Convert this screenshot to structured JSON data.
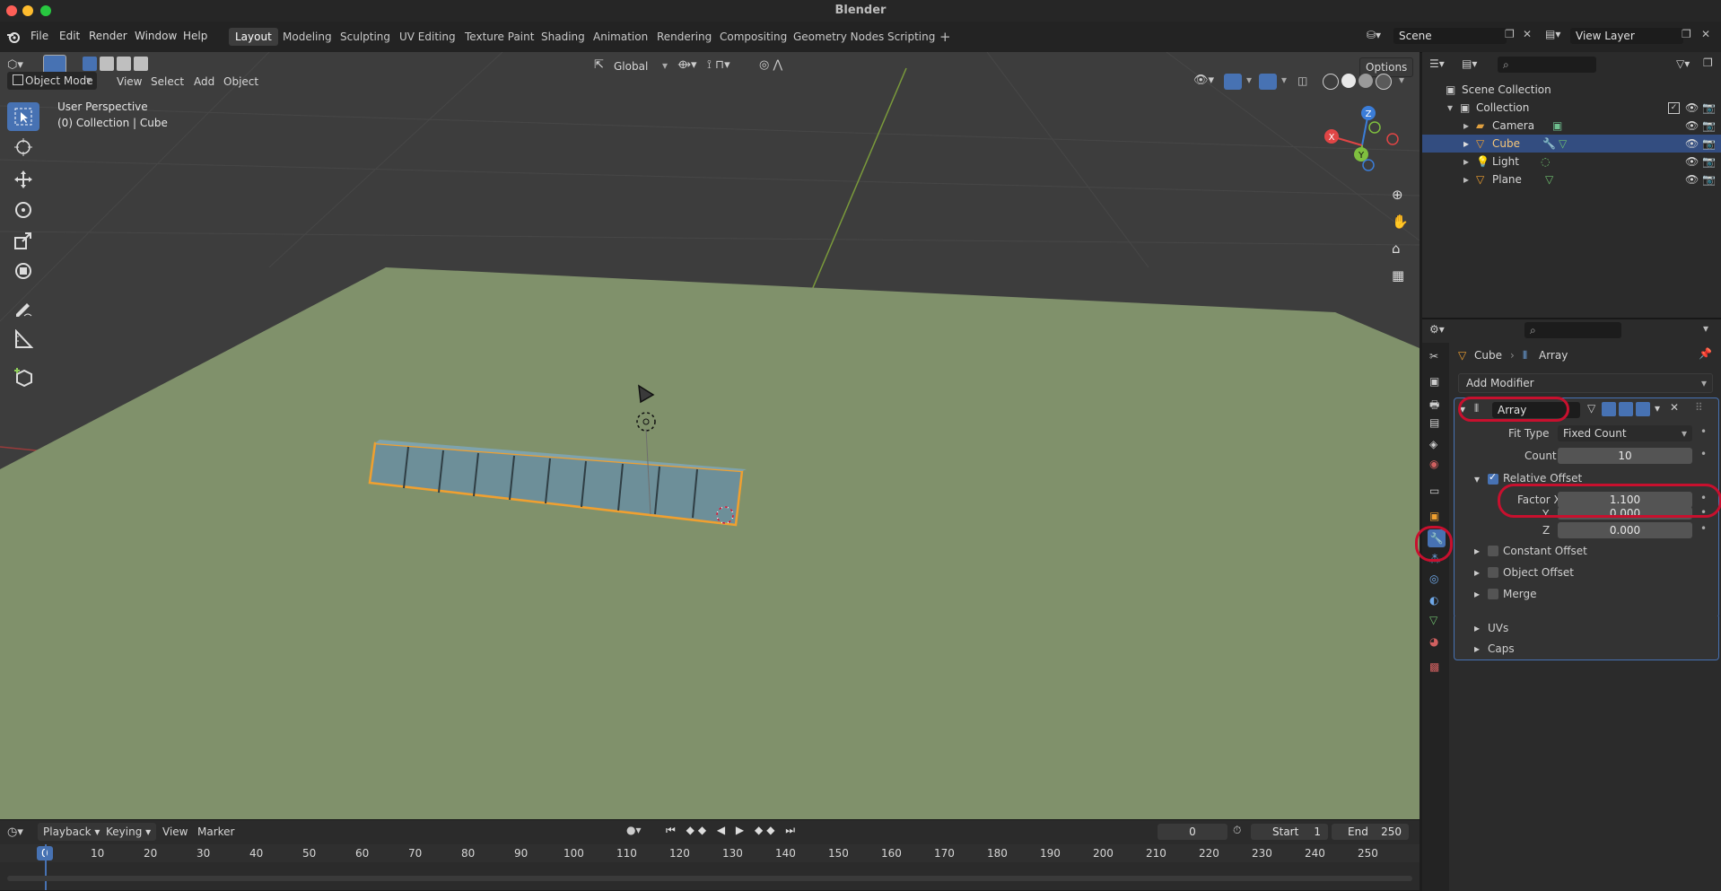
{
  "window": {
    "title": "Blender"
  },
  "menu": {
    "file": "File",
    "edit": "Edit",
    "render": "Render",
    "window": "Window",
    "help": "Help"
  },
  "workspaces": [
    "Layout",
    "Modeling",
    "Sculpting",
    "UV Editing",
    "Texture Paint",
    "Shading",
    "Animation",
    "Rendering",
    "Compositing",
    "Geometry Nodes",
    "Scripting"
  ],
  "scene": {
    "name": "Scene",
    "view_layer": "View Layer"
  },
  "viewport": {
    "mode": "Object Mode",
    "menus": {
      "view": "View",
      "select": "Select",
      "add": "Add",
      "object": "Object"
    },
    "transform_orientation": "Global",
    "options": "Options",
    "perspective_label": "User Perspective",
    "collection_label": "(0) Collection | Cube",
    "gizmo": {
      "x": "X",
      "y": "Y",
      "z": "Z"
    }
  },
  "outliner": {
    "scene_collection": "Scene Collection",
    "collection": "Collection",
    "items": [
      "Camera",
      "Cube",
      "Light",
      "Plane"
    ],
    "selected": "Cube"
  },
  "properties": {
    "breadcrumb_object": "Cube",
    "breadcrumb_modifier": "Array",
    "add_modifier": "Add Modifier",
    "modifier_name": "Array",
    "fit_type_label": "Fit Type",
    "fit_type_value": "Fixed Count",
    "count_label": "Count",
    "count_value": "10",
    "relative_offset_label": "Relative Offset",
    "factor_x_label": "Factor X",
    "factor_x_value": "1.100",
    "y_label": "Y",
    "y_value": "0.000",
    "z_label": "Z",
    "z_value": "0.000",
    "constant_offset": "Constant Offset",
    "object_offset": "Object Offset",
    "merge": "Merge",
    "uvs": "UVs",
    "caps": "Caps"
  },
  "timeline": {
    "playback": "Playback",
    "keying": "Keying",
    "view": "View",
    "marker": "Marker",
    "current_frame": "0",
    "start_label": "Start",
    "start_value": "1",
    "end_label": "End",
    "end_value": "250",
    "ruler_current": "0",
    "ruler": [
      "10",
      "20",
      "30",
      "40",
      "50",
      "60",
      "70",
      "80",
      "90",
      "100",
      "110",
      "120",
      "130",
      "140",
      "150",
      "160",
      "170",
      "180",
      "190",
      "200",
      "210",
      "220",
      "230",
      "240",
      "250"
    ]
  },
  "colors": {
    "accent": "#4772b3",
    "selection_orange": "#f0a030",
    "highlight_ring": "#c8102e",
    "ground": "#80916b"
  }
}
